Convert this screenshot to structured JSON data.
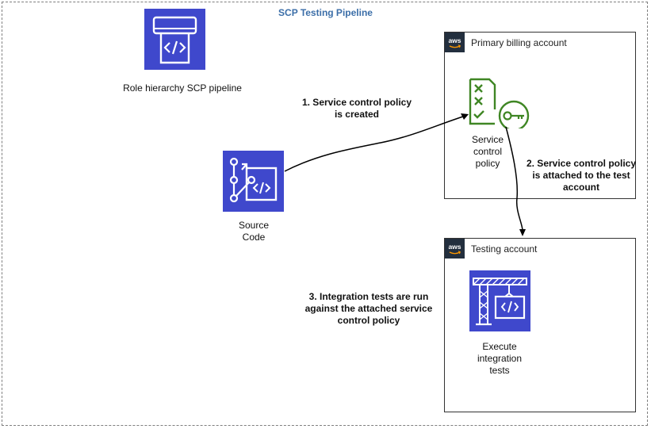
{
  "title": "SCP Testing Pipeline",
  "pipeline": {
    "label": "Role hierarchy SCP pipeline"
  },
  "source": {
    "label_line1": "Source",
    "label_line2": "Code"
  },
  "primary_account": {
    "label": "Primary billing account",
    "scp_line1": "Service",
    "scp_line2": "control",
    "scp_line3": "policy"
  },
  "testing_account": {
    "label": "Testing account",
    "exec_line1": "Execute",
    "exec_line2": "integration",
    "exec_line3": "tests"
  },
  "steps": {
    "s1_line1": "1. Service control policy",
    "s1_line2": "is created",
    "s2_line1": "2. Service control policy",
    "s2_line2": "is attached to the test",
    "s2_line3": "account",
    "s3_line1": "3. Integration tests are run",
    "s3_line2": "against the attached service",
    "s3_line3": "control policy"
  },
  "aws_logo_text": "aws",
  "colors": {
    "tile": "#3f48cc",
    "title": "#3b6ea8",
    "policy_green": "#3f8624",
    "aws_dark": "#232f3e"
  }
}
